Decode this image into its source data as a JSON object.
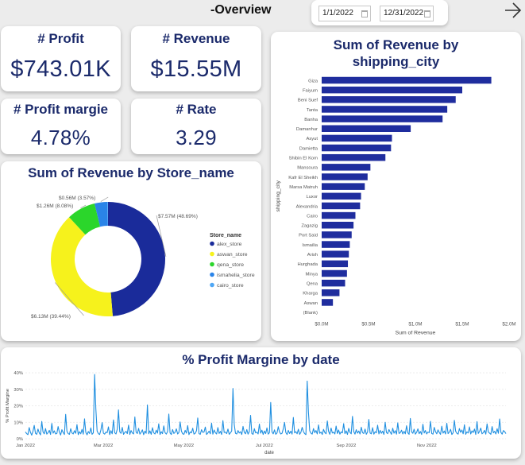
{
  "header": {
    "title": "-Overview",
    "date_start": "1/1/2022",
    "date_end": "12/31/2022",
    "nav_icon": "arrow-right-icon"
  },
  "kpis": {
    "profit": {
      "label": "# Profit",
      "value": "$743.01K"
    },
    "revenue": {
      "label": "# Revenue",
      "value": "$15.55M"
    },
    "profit_margin": {
      "label": "# Profit margie",
      "value": "4.78%"
    },
    "rate": {
      "label": "# Rate",
      "value": "3.29"
    }
  },
  "colors": {
    "title": "#1b2a6b",
    "bar": "#1f2d9e",
    "line": "#1f8fe0",
    "donut": [
      "#1a2b9a",
      "#f6f21c",
      "#2bd62b",
      "#2a84e8",
      "#4fa7f5"
    ]
  },
  "chart_data": [
    {
      "type": "pie",
      "title": "Sum of Revenue by Store_name",
      "legend_title": "Store_name",
      "legend_position": "right",
      "categories": [
        "alex_store",
        "aswan_store",
        "qena_store",
        "ismahelia_store",
        "cairo_store"
      ],
      "values": [
        7.57,
        6.13,
        1.26,
        0.56,
        0.03
      ],
      "value_unit": "M",
      "data_labels": [
        "$7.57M (48.69%)",
        "$6.13M (39.44%)",
        "$1.26M (8.08%)",
        "$0.56M (3.57%)",
        ""
      ]
    },
    {
      "type": "bar",
      "orientation": "horizontal",
      "title": "Sum of Revenue by shipping_city",
      "xlabel": "Sum of Revenue",
      "ylabel": "shipping_city",
      "xlim": [
        0,
        2000000
      ],
      "xticks": [
        "$0.0M",
        "$0.5M",
        "$1.0M",
        "$1.5M",
        "$2.0M"
      ],
      "categories": [
        "Giza",
        "Faiyum",
        "Beni Suef",
        "Tanta",
        "Banha",
        "Damanhur",
        "Asyut",
        "Damietta",
        "Shibin El Kom",
        "Mansoura",
        "Kafr El Sheikh",
        "Marsa Matruh",
        "Luxor",
        "Alexandria",
        "Cairo",
        "Zagazig",
        "Port Said",
        "Ismailia",
        "Arish",
        "Hurghada",
        "Minya",
        "Qena",
        "Kharga",
        "Aswan",
        "(Blank)"
      ],
      "values": [
        1810000,
        1500000,
        1430000,
        1340000,
        1290000,
        950000,
        750000,
        740000,
        680000,
        520000,
        490000,
        460000,
        420000,
        410000,
        360000,
        340000,
        320000,
        300000,
        290000,
        280000,
        270000,
        250000,
        190000,
        120000,
        0
      ]
    },
    {
      "type": "line",
      "title": "% Profit Margine by date",
      "xlabel": "date",
      "ylabel": "% Profit Margine",
      "ylim": [
        0,
        40
      ],
      "yticks": [
        "0%",
        "10%",
        "20%",
        "30%",
        "40%"
      ],
      "xticks": [
        "Jan 2022",
        "Mar 2022",
        "May 2022",
        "Jul 2022",
        "Sep 2022",
        "Nov 2022"
      ],
      "date_range": [
        "2022-01-01",
        "2022-12-31"
      ],
      "series": [
        {
          "values": [
            4.2,
            3.1,
            2.5,
            6.8,
            3.9,
            2.2,
            4.5,
            8.1,
            3.3,
            2.7,
            5.9,
            3.6,
            2.4,
            10.5,
            4.1,
            3.0,
            6.2,
            2.8,
            3.7,
            5.1,
            2.6,
            9.3,
            3.4,
            4.8,
            2.9,
            3.2,
            7.4,
            4.0,
            2.3,
            5.5,
            3.8,
            2.6,
            14.8,
            4.6,
            3.1,
            2.7,
            6.1,
            3.5,
            2.9,
            4.9,
            3.3,
            8.6,
            2.5,
            4.3,
            3.0,
            5.7,
            2.8,
            12.1,
            3.9,
            2.4,
            4.4,
            3.2,
            6.6,
            2.7,
            3.6,
            39.0,
            18.0,
            4.7,
            3.1,
            2.6,
            5.3,
            9.8,
            3.4,
            2.8,
            4.1,
            3.7,
            7.2,
            2.5,
            4.9,
            3.0,
            11.4,
            3.6,
            2.9,
            5.8,
            17.5,
            4.2,
            3.3,
            6.9,
            2.7,
            3.8,
            4.5,
            3.1,
            8.3,
            2.6,
            5.0,
            3.5,
            2.9,
            13.2,
            4.0,
            3.2,
            6.3,
            2.8,
            3.9,
            5.4,
            2.5,
            4.6,
            3.3,
            20.5,
            3.0,
            4.8,
            2.7,
            6.7,
            3.6,
            2.9,
            5.2,
            3.4,
            9.1,
            2.6,
            4.3,
            3.1,
            7.8,
            3.7,
            2.8,
            4.4,
            15.0,
            3.5,
            2.6,
            5.6,
            3.2,
            4.0,
            6.0,
            2.9,
            3.8,
            10.2,
            4.7,
            3.0,
            2.7,
            5.1,
            3.4,
            8.0,
            2.5,
            4.2,
            3.6,
            6.4,
            2.8,
            3.3,
            4.9,
            12.6,
            3.1,
            2.7,
            5.5,
            3.9,
            4.1,
            7.1,
            2.6,
            3.5,
            4.6,
            3.0,
            9.5,
            2.8,
            5.3,
            3.7,
            2.9,
            6.8,
            3.2,
            4.5,
            2.6,
            11.0,
            3.8,
            4.0,
            3.1,
            5.9,
            2.7,
            3.6,
            4.8,
            30.5,
            8.7,
            3.3,
            2.9,
            5.0,
            3.5,
            4.3,
            2.6,
            7.5,
            3.9,
            3.0,
            5.6,
            2.8,
            4.4,
            14.2,
            3.2,
            2.7,
            6.1,
            3.6,
            4.0,
            2.9,
            8.9,
            3.4,
            5.2,
            2.6,
            4.7,
            3.1,
            6.6,
            2.8,
            3.7,
            22.0,
            4.2,
            3.0,
            5.4,
            2.7,
            3.5,
            7.3,
            4.1,
            2.9,
            3.3,
            6.0,
            9.9,
            3.8,
            2.6,
            5.1,
            3.2,
            4.6,
            2.8,
            12.9,
            3.6,
            4.3,
            3.0,
            5.8,
            2.7,
            3.9,
            6.9,
            4.4,
            3.1,
            2.5,
            35.0,
            16.0,
            4.9,
            3.4,
            2.8,
            6.2,
            3.7,
            5.0,
            2.9,
            8.4,
            3.3,
            4.1,
            2.6,
            5.7,
            3.8,
            3.0,
            10.8,
            4.5,
            2.7,
            6.5,
            3.5,
            4.0,
            2.9,
            7.7,
            3.2,
            5.3,
            2.8,
            4.2,
            3.6,
            9.2,
            3.1,
            4.8,
            2.6,
            6.3,
            3.9,
            3.0,
            13.6,
            4.4,
            2.8,
            5.5,
            3.4,
            4.7,
            2.9,
            7.0,
            3.7,
            3.2,
            5.9,
            2.7,
            4.1,
            11.7,
            3.5,
            3.0,
            6.7,
            2.8,
            4.3,
            3.6,
            8.2,
            2.9,
            5.1,
            3.3,
            4.6,
            2.6,
            10.0,
            3.8,
            3.1,
            5.6,
            4.0,
            2.7,
            6.4,
            3.4,
            4.9,
            2.8,
            9.6,
            3.2,
            3.7,
            5.2,
            2.9,
            4.5,
            3.0,
            7.9,
            3.6,
            2.7,
            12.3,
            4.2,
            3.3,
            5.8,
            2.8,
            3.9,
            6.0,
            3.1,
            4.4,
            2.6,
            8.8,
            3.5,
            5.0,
            2.9,
            4.1,
            3.7,
            10.6,
            3.2,
            2.8,
            6.9,
            4.3,
            3.0,
            5.4,
            3.8,
            2.7,
            7.6,
            3.4,
            4.7,
            2.9,
            9.4,
            3.1,
            4.0,
            5.7,
            2.6,
            3.6,
            11.2,
            4.6,
            3.3,
            2.8,
            6.2,
            3.9,
            5.3,
            3.0,
            8.5,
            2.7,
            4.2,
            3.5,
            7.2,
            2.9,
            4.8,
            3.8,
            5.9,
            2.6,
            10.4,
            3.2,
            4.4,
            6.5,
            3.0,
            3.7,
            5.1,
            2.8,
            9.0,
            4.1,
            3.4,
            2.7,
            7.4,
            3.6,
            4.5,
            2.9,
            6.1,
            3.3,
            12.0,
            3.9,
            2.8,
            5.0,
            4.3,
            3.1
          ]
        }
      ]
    }
  ]
}
